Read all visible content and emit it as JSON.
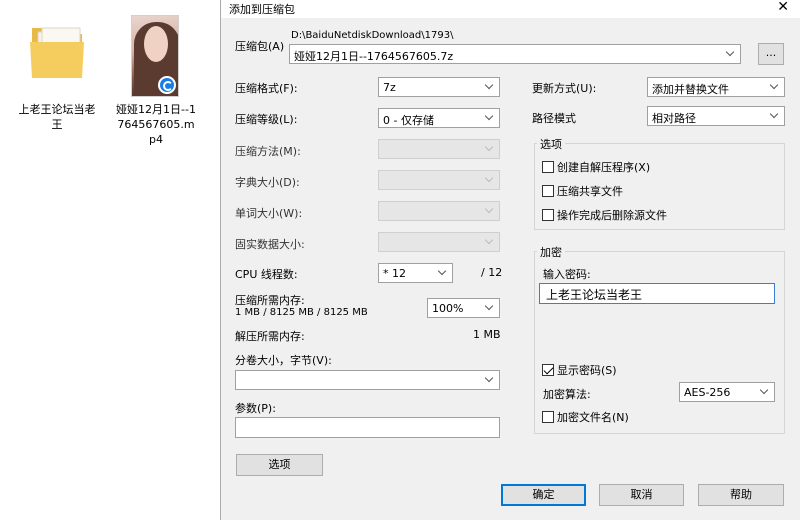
{
  "desktop": {
    "folder_label": "上老王论坛当老王",
    "video_label": "娅娅12月1日--1764567605.mp4"
  },
  "dialog": {
    "title": "添加到压缩包",
    "archive_label": "压缩包(A)",
    "archive_path": "D:\\BaiduNetdiskDownload\\1793\\",
    "archive_name": "娅娅12月1日--1764567605.7z",
    "browse_label": "...",
    "format_label": "压缩格式(F):",
    "format_value": "7z",
    "level_label": "压缩等级(L):",
    "level_value": "0 - 仅存储",
    "method_label": "压缩方法(M):",
    "dict_label": "字典大小(D):",
    "word_label": "单词大小(W):",
    "solid_label": "固实数据大小:",
    "cpu_label": "CPU 线程数:",
    "cpu_value": "* 12",
    "cpu_total": "/ 12",
    "mem_compress_label": "压缩所需内存:",
    "mem_compress_value": "1 MB / 8125 MB / 8125 MB",
    "mem_percent": "100%",
    "mem_decompress_label": "解压所需内存:",
    "mem_decompress_value": "1 MB",
    "split_label": "分卷大小，字节(V):",
    "params_label": "参数(P):",
    "options_button": "选项",
    "update_label": "更新方式(U):",
    "update_value": "添加并替换文件",
    "path_label": "路径模式",
    "path_value": "相对路径",
    "options_group": "选项",
    "opt_sfx": "创建自解压程序(X)",
    "opt_shared": "压缩共享文件",
    "opt_delete": "操作完成后删除源文件",
    "encrypt_group": "加密",
    "password_label": "输入密码:",
    "password_value": "上老王论坛当老王",
    "show_password": "显示密码(S)",
    "enc_method_label": "加密算法:",
    "enc_method_value": "AES-256",
    "encrypt_names": "加密文件名(N)",
    "ok_button": "确定",
    "cancel_button": "取消",
    "help_button": "帮助"
  }
}
